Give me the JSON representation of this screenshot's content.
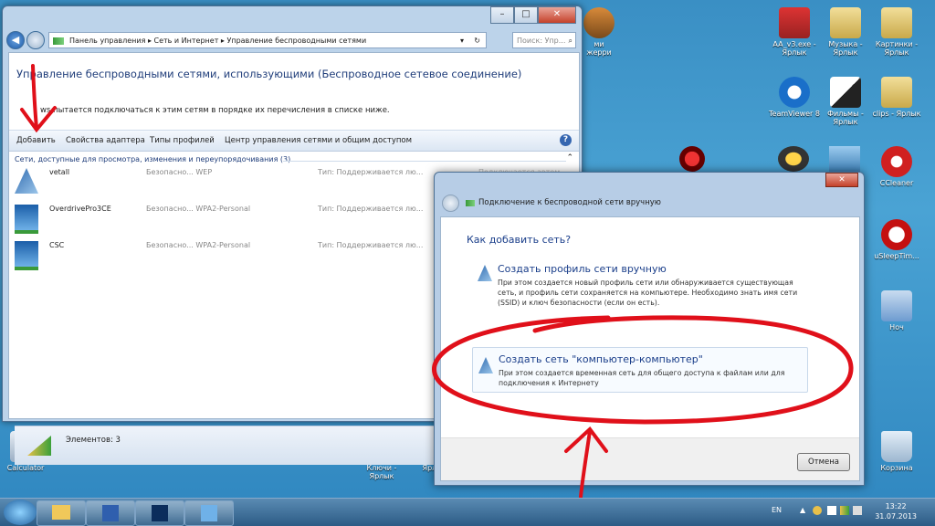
{
  "desktop": {
    "right_icons": [
      {
        "label": "AA_v3.exe - Ярлык",
        "icon": "aa-icon"
      },
      {
        "label": "Музыка - Ярлык",
        "icon": "music-folder-icon"
      },
      {
        "label": "Картинки - Ярлык",
        "icon": "pictures-folder-icon"
      },
      {
        "label": "TeamViewer 8",
        "icon": "teamviewer-icon"
      },
      {
        "label": "Фильмы - Ярлык",
        "icon": "movies-folder-icon"
      },
      {
        "label": "clips - Ярлык",
        "icon": "folder-icon"
      },
      {
        "label": "CCleaner",
        "icon": "ccleaner-icon"
      },
      {
        "label": "uSleepTim...",
        "icon": "alarm-clock-icon"
      },
      {
        "label": "Ноч",
        "icon": "network-icon"
      },
      {
        "label": "Корзина",
        "icon": "recycle-bin-icon"
      }
    ],
    "left_icons": [
      {
        "label": "Calculator",
        "icon": "calculator-icon"
      }
    ],
    "bottom_icons": [
      {
        "label": "Ключи - Ярлык",
        "icon": "folder-icon"
      },
      {
        "label": "Ярлык",
        "icon": "folder-icon"
      }
    ],
    "partial_label": "ми\nжерри"
  },
  "main_window": {
    "address_parts": [
      "Панель управления",
      "Сеть и Интернет",
      "Управление беспроводными сетями"
    ],
    "search_placeholder": "Поиск: Упр...",
    "heading": "Управление беспроводными сетями, использующими (Беспроводное сетевое соединение)",
    "subtext": "Windows пытается подключаться к этим сетям в порядке их перечисления в списке ниже.",
    "subtext_visible": "ws пытается подключаться к этим сетям в порядке их перечисления в списке ниже.",
    "toolbar": {
      "add": "Добавить",
      "adapter_props": "Свойства адаптера",
      "profile_types": "Типы профилей",
      "network_center": "Центр управления сетями и общим доступом"
    },
    "group_header": "Сети, доступные для просмотра, изменения и переупорядочивания (3)",
    "networks": [
      {
        "name": "vetall",
        "security": "Безопасно...  WEP",
        "type": "Тип: Поддерживается лю...",
        "extra": "Подключается автом..."
      },
      {
        "name": "OverdrivePro3CE",
        "security": "Безопасно...  WPA2-Personal",
        "type": "Тип: Поддерживается лю...",
        "extra": ""
      },
      {
        "name": "CSC",
        "security": "Безопасно...  WPA2-Personal",
        "type": "Тип: Поддерживается лю...",
        "extra": ""
      }
    ],
    "status": "Элементов: 3"
  },
  "dialog": {
    "title": "Подключение к беспроводной сети вручную",
    "question": "Как добавить сеть?",
    "options": [
      {
        "title": "Создать профиль сети вручную",
        "desc": "При этом создается новый профиль сети или обнаруживается существующая сеть, и профиль сети сохраняется на компьютере. Необходимо знать имя сети (SSID) и ключ безопасности (если он есть)."
      },
      {
        "title": "Создать сеть \"компьютер-компьютер\"",
        "desc": "При этом создается временная сеть для общего доступа к файлам или для подключения к Интернету"
      }
    ],
    "cancel": "Отмена"
  },
  "taskbar": {
    "language": "EN",
    "time": "13:22",
    "date": "31.07.2013"
  },
  "colors": {
    "annotation_red": "#e0101a",
    "link_blue": "#1a3e8a",
    "desktop_blue": "#3a8fc4"
  }
}
